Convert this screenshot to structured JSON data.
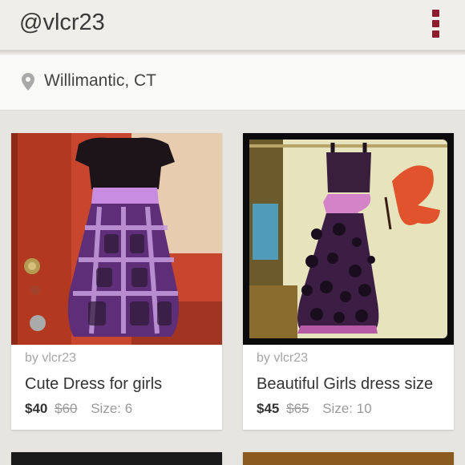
{
  "header": {
    "title": "@vlcr23",
    "menu_icon": "overflow-menu-icon",
    "accent": "#8b1d2c"
  },
  "location": {
    "icon": "location-pin-icon",
    "text": "Willimantic, CT"
  },
  "listings": [
    {
      "by": "by vlcr23",
      "title": "Cute Dress for girls",
      "price": "$40",
      "original_price": "$60",
      "size": "Size: 6"
    },
    {
      "by": "by vlcr23",
      "title": "Beautiful Girls dress size",
      "price": "$45",
      "original_price": "$65",
      "size": "Size: 10"
    }
  ]
}
